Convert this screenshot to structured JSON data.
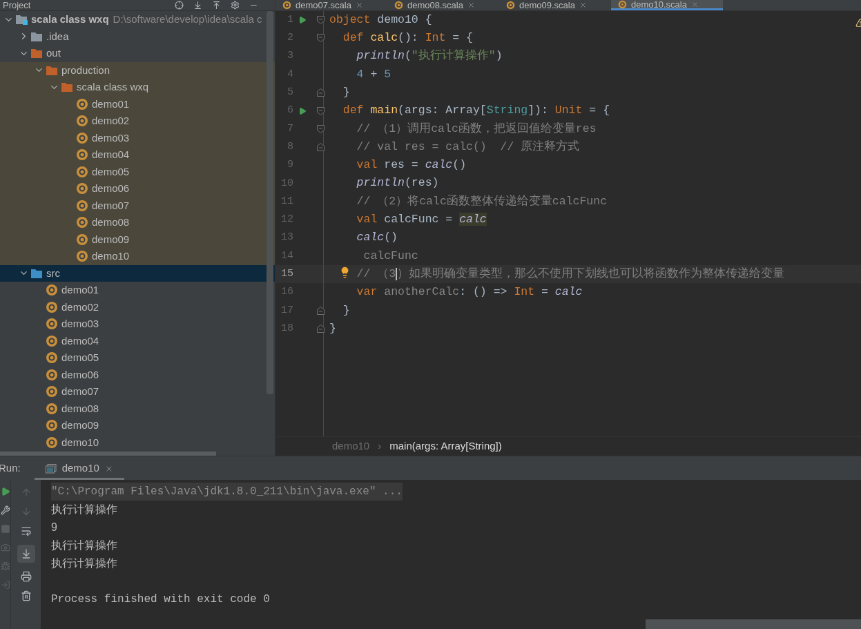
{
  "project_panel": {
    "title": "Project",
    "tree": [
      {
        "label": "scala class wxq",
        "path": "D:\\software\\develop\\idea\\scala c",
        "kind": "project",
        "expanded": true,
        "selected": false,
        "children": [
          {
            "label": ".idea",
            "kind": "folder",
            "expanded": false,
            "selected": false
          },
          {
            "label": "out",
            "kind": "excluded-folder",
            "expanded": true,
            "selected": false,
            "children": [
              {
                "label": "production",
                "kind": "excluded-folder",
                "expanded": true,
                "selected": false,
                "children": [
                  {
                    "label": "scala class wxq",
                    "kind": "excluded-folder",
                    "expanded": true,
                    "selected": false,
                    "children": [
                      {
                        "label": "demo01",
                        "kind": "object",
                        "selected": false
                      },
                      {
                        "label": "demo02",
                        "kind": "object",
                        "selected": false
                      },
                      {
                        "label": "demo03",
                        "kind": "object",
                        "selected": false
                      },
                      {
                        "label": "demo04",
                        "kind": "object",
                        "selected": false
                      },
                      {
                        "label": "demo05",
                        "kind": "object",
                        "selected": false
                      },
                      {
                        "label": "demo06",
                        "kind": "object",
                        "selected": false
                      },
                      {
                        "label": "demo07",
                        "kind": "object",
                        "selected": false
                      },
                      {
                        "label": "demo08",
                        "kind": "object",
                        "selected": false
                      },
                      {
                        "label": "demo09",
                        "kind": "object",
                        "selected": false
                      },
                      {
                        "label": "demo10",
                        "kind": "object",
                        "selected": false
                      }
                    ]
                  }
                ]
              }
            ]
          },
          {
            "label": "src",
            "kind": "source-folder",
            "expanded": true,
            "selected": true,
            "children": [
              {
                "label": "demo01",
                "kind": "object",
                "selected": false
              },
              {
                "label": "demo02",
                "kind": "object",
                "selected": false
              },
              {
                "label": "demo03",
                "kind": "object",
                "selected": false
              },
              {
                "label": "demo04",
                "kind": "object",
                "selected": false
              },
              {
                "label": "demo05",
                "kind": "object",
                "selected": false
              },
              {
                "label": "demo06",
                "kind": "object",
                "selected": false
              },
              {
                "label": "demo07",
                "kind": "object",
                "selected": false
              },
              {
                "label": "demo08",
                "kind": "object",
                "selected": false
              },
              {
                "label": "demo09",
                "kind": "object",
                "selected": false
              },
              {
                "label": "demo10",
                "kind": "object",
                "selected": false
              }
            ]
          }
        ]
      }
    ]
  },
  "editor": {
    "tabs": [
      {
        "label": "demo07.scala",
        "selected": false
      },
      {
        "label": "demo08.scala",
        "selected": false
      },
      {
        "label": "demo09.scala",
        "selected": false
      },
      {
        "label": "demo10.scala",
        "selected": true
      }
    ],
    "lines": [
      {
        "number": "1",
        "run": true,
        "fold_start": true,
        "fold_end": false,
        "selected": false,
        "bulb": false,
        "tokens": [
          {
            "text": "object",
            "kind": "keyword"
          },
          {
            "text": " demo10 {",
            "kind": "plain"
          }
        ]
      },
      {
        "number": "2",
        "run": false,
        "fold_start": true,
        "fold_end": false,
        "selected": false,
        "bulb": false,
        "tokens": [
          {
            "text": "  def",
            "kind": "keyword"
          },
          {
            "text": " calc",
            "kind": "function"
          },
          {
            "text": "(): ",
            "kind": "plain"
          },
          {
            "text": "Int",
            "kind": "keyword"
          },
          {
            "text": " = {",
            "kind": "plain"
          }
        ]
      },
      {
        "number": "3",
        "run": false,
        "fold_start": false,
        "fold_end": false,
        "selected": false,
        "bulb": false,
        "tokens": [
          {
            "text": "    println",
            "kind": "call"
          },
          {
            "text": "(",
            "kind": "plain"
          },
          {
            "text": "\"执行计算操作\"",
            "kind": "string"
          },
          {
            "text": ")",
            "kind": "plain"
          }
        ]
      },
      {
        "number": "4",
        "run": false,
        "fold_start": false,
        "fold_end": false,
        "selected": false,
        "bulb": false,
        "tokens": [
          {
            "text": "    4",
            "kind": "number"
          },
          {
            "text": " + ",
            "kind": "plain"
          },
          {
            "text": "5",
            "kind": "number"
          }
        ]
      },
      {
        "number": "5",
        "run": false,
        "fold_start": false,
        "fold_end": true,
        "selected": false,
        "bulb": false,
        "tokens": [
          {
            "text": "  }",
            "kind": "plain"
          }
        ]
      },
      {
        "number": "6",
        "run": true,
        "fold_start": true,
        "fold_end": false,
        "selected": false,
        "bulb": false,
        "tokens": [
          {
            "text": "  def",
            "kind": "keyword"
          },
          {
            "text": " main",
            "kind": "function"
          },
          {
            "text": "(args: Array[",
            "kind": "plain"
          },
          {
            "text": "String",
            "kind": "type"
          },
          {
            "text": "]): ",
            "kind": "plain"
          },
          {
            "text": "Unit",
            "kind": "keyword"
          },
          {
            "text": " = {",
            "kind": "plain"
          }
        ]
      },
      {
        "number": "7",
        "run": false,
        "fold_start": true,
        "fold_end": false,
        "selected": false,
        "bulb": false,
        "tokens": [
          {
            "text": "    // （1）调用calc函数，把返回值给变量res",
            "kind": "comment"
          }
        ]
      },
      {
        "number": "8",
        "run": false,
        "fold_start": false,
        "fold_end": true,
        "selected": false,
        "bulb": false,
        "tokens": [
          {
            "text": "    // val res = calc()  // 原注释方式",
            "kind": "comment"
          }
        ]
      },
      {
        "number": "9",
        "run": false,
        "fold_start": false,
        "fold_end": false,
        "selected": false,
        "bulb": false,
        "tokens": [
          {
            "text": "    val",
            "kind": "keyword"
          },
          {
            "text": " res = ",
            "kind": "plain"
          },
          {
            "text": "calc",
            "kind": "call"
          },
          {
            "text": "()",
            "kind": "plain"
          }
        ]
      },
      {
        "number": "10",
        "run": false,
        "fold_start": false,
        "fold_end": false,
        "selected": false,
        "bulb": false,
        "tokens": [
          {
            "text": "    println",
            "kind": "call"
          },
          {
            "text": "(res)",
            "kind": "plain"
          }
        ]
      },
      {
        "number": "11",
        "run": false,
        "fold_start": false,
        "fold_end": false,
        "selected": false,
        "bulb": false,
        "tokens": [
          {
            "text": "    // （2）将calc函数整体传递给变量calcFunc",
            "kind": "comment"
          }
        ]
      },
      {
        "number": "12",
        "run": false,
        "fold_start": false,
        "fold_end": false,
        "selected": false,
        "bulb": false,
        "tokens": [
          {
            "text": "    val",
            "kind": "keyword"
          },
          {
            "text": " calcFunc = ",
            "kind": "plain"
          },
          {
            "text": "calc",
            "kind": "highlighted-call"
          }
        ]
      },
      {
        "number": "13",
        "run": false,
        "fold_start": false,
        "fold_end": false,
        "selected": false,
        "bulb": false,
        "tokens": [
          {
            "text": "    calc",
            "kind": "call"
          },
          {
            "text": "()",
            "kind": "plain"
          }
        ]
      },
      {
        "number": "14",
        "run": false,
        "fold_start": false,
        "fold_end": false,
        "selected": false,
        "bulb": false,
        "tokens": [
          {
            "text": "     calcFunc",
            "kind": "unused"
          }
        ]
      },
      {
        "number": "15",
        "run": false,
        "fold_start": false,
        "fold_end": false,
        "selected": true,
        "bulb": true,
        "tokens": [
          {
            "text": "    // （3",
            "kind": "comment",
            "caret_after": true
          },
          {
            "text": "）如果明确变量类型，那么不使用下划线也可以将函数作为整体传递给变量",
            "kind": "comment"
          }
        ]
      },
      {
        "number": "16",
        "run": false,
        "fold_start": false,
        "fold_end": false,
        "selected": false,
        "bulb": false,
        "tokens": [
          {
            "text": "    var",
            "kind": "keyword"
          },
          {
            "text": " anotherCalc",
            "kind": "unused"
          },
          {
            "text": ": () => ",
            "kind": "plain"
          },
          {
            "text": "Int",
            "kind": "keyword"
          },
          {
            "text": " = ",
            "kind": "plain"
          },
          {
            "text": "calc",
            "kind": "call"
          }
        ]
      },
      {
        "number": "17",
        "run": false,
        "fold_start": false,
        "fold_end": true,
        "selected": false,
        "bulb": false,
        "tokens": [
          {
            "text": "  }",
            "kind": "plain"
          }
        ]
      },
      {
        "number": "18",
        "run": false,
        "fold_start": false,
        "fold_end": true,
        "selected": false,
        "bulb": false,
        "tokens": [
          {
            "text": "}",
            "kind": "plain"
          }
        ]
      }
    ],
    "breadcrumbs": [
      {
        "label": "demo10",
        "selected": false
      },
      {
        "label": "main(args: Array[String])",
        "selected": true
      }
    ],
    "breadcrumb_separator": "›"
  },
  "run_panel": {
    "label": "Run:",
    "tabs": [
      {
        "label": "demo10",
        "selected": true
      }
    ],
    "console": [
      {
        "text": "\"C:\\Program Files\\Java\\jdk1.8.0_211\\bin\\java.exe\" ...",
        "kind": "command"
      },
      {
        "text": "执行计算操作",
        "kind": "output"
      },
      {
        "text": "9",
        "kind": "output"
      },
      {
        "text": "执行计算操作",
        "kind": "output"
      },
      {
        "text": "执行计算操作",
        "kind": "output"
      },
      {
        "text": "Process finished with exit code 0",
        "kind": "exit"
      }
    ]
  }
}
